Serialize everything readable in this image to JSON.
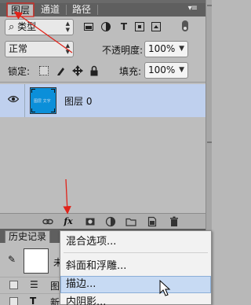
{
  "tabs": [
    {
      "label": "图层",
      "active": true
    },
    {
      "label": "通道",
      "active": false
    },
    {
      "label": "路径",
      "active": false
    }
  ],
  "panel_close_glyph": "◀◀",
  "panel_menu_glyph": "▾≡",
  "filter": {
    "kind_search_glyph": "⌕",
    "kind_label": "类型",
    "icons": [
      "image-filter-icon",
      "adjustment-filter-icon",
      "type-filter-icon",
      "shape-filter-icon",
      "smart-object-filter-icon"
    ]
  },
  "blend": {
    "mode": "正常",
    "opacity_label": "不透明度:",
    "opacity_value": "100%"
  },
  "lock": {
    "label": "锁定:",
    "fill_label": "填充:",
    "fill_value": "100%"
  },
  "layer": {
    "name": "图层 0",
    "thumb_text": "图层 文字",
    "thumb_color": "#0b8fd9",
    "selected_bg": "#bfd0ee"
  },
  "footer_buttons": [
    "link-icon",
    "fx-icon",
    "mask-icon",
    "adjustment-icon",
    "folder-icon",
    "new-layer-icon",
    "trash-icon"
  ],
  "fx_label": "fx",
  "history": {
    "tab_label": "历史记录",
    "snapshot_suffix": "未",
    "rows": [
      {
        "icon": "☰",
        "text": "图"
      },
      {
        "icon": "T",
        "text": "新"
      }
    ]
  },
  "menu": {
    "items": [
      {
        "label": "混合选项...",
        "highlighted": false
      },
      {
        "label": "斜面和浮雕...",
        "highlighted": false
      },
      {
        "label": "描边...",
        "highlighted": true
      },
      {
        "label": "内阴影...",
        "highlighted": false
      }
    ]
  },
  "colors": {
    "accent_red": "#e0231a",
    "menu_highlight": "#c7daf3"
  }
}
